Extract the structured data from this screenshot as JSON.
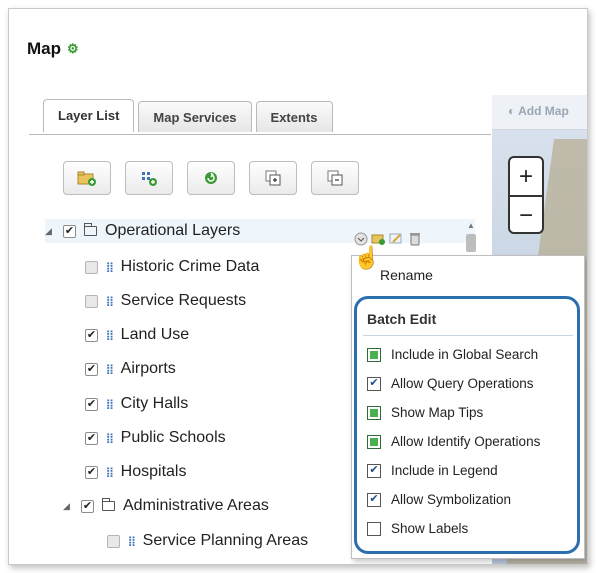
{
  "title": "Map",
  "tabs": [
    "Layer List",
    "Map Services",
    "Extents"
  ],
  "map": {
    "add_map": "Add Map",
    "zoom_in": "+",
    "zoom_out": "−"
  },
  "toolbar": [
    "add-folder-icon",
    "add-layer-icon",
    "refresh-icon",
    "expand-all-icon",
    "collapse-all-icon"
  ],
  "tree": {
    "group": "Operational Layers",
    "items": [
      {
        "label": "Historic Crime Data",
        "checked": false
      },
      {
        "label": "Service Requests",
        "checked": false
      },
      {
        "label": "Land Use",
        "checked": true
      },
      {
        "label": "Airports",
        "checked": true
      },
      {
        "label": "City Halls",
        "checked": true
      },
      {
        "label": "Public Schools",
        "checked": true
      },
      {
        "label": "Hospitals",
        "checked": true
      }
    ],
    "subgroup": "Administrative Areas",
    "subitem": "Service Planning Areas"
  },
  "menu": {
    "rename": "Rename",
    "batch_title": "Batch Edit",
    "options": [
      {
        "label": "Include in Global Search",
        "state": "partial"
      },
      {
        "label": "Allow Query Operations",
        "state": "checked"
      },
      {
        "label": "Show Map Tips",
        "state": "partial"
      },
      {
        "label": "Allow Identify Operations",
        "state": "partial"
      },
      {
        "label": "Include in Legend",
        "state": "checked"
      },
      {
        "label": "Allow Symbolization",
        "state": "checked"
      },
      {
        "label": "Show Labels",
        "state": "empty"
      }
    ]
  },
  "colors": {
    "accent": "#2c6fad",
    "layer_icon": "#3b74b8",
    "partial_fill": "#4caf50"
  }
}
